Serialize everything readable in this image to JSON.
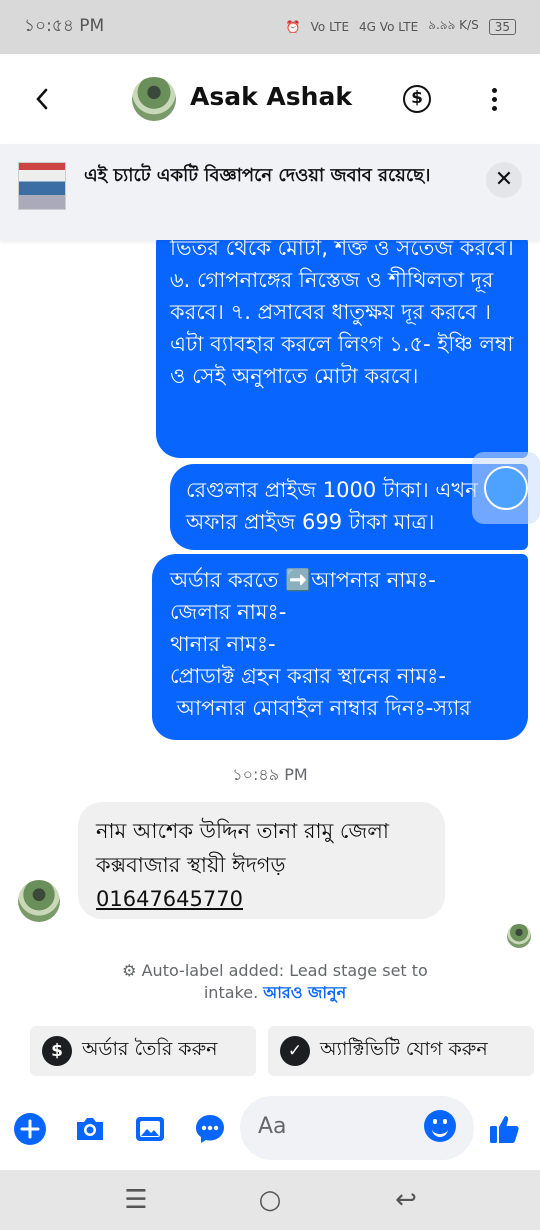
{
  "status_bar": {
    "time": "১০:৫৪ PM",
    "signal1": "Vo LTE",
    "signal2": "4G Vo LTE",
    "speed": "৯.৯৯ K/S",
    "battery": "35"
  },
  "header": {
    "contact_name": "Asak Ashak",
    "back_icon": "chevron-left-icon",
    "dollar_icon": "dollar-circle-icon",
    "more_icon": "vertical-dots-icon"
  },
  "ad_banner": {
    "text": "এই চ্যাটে একটি বিজ্ঞাপনে দেওয়া জবাব রয়েছে।",
    "close_icon": "close-icon"
  },
  "messages": {
    "out1": "ভিতর থেকে মোটা, শক্ত ও সতেজ করবে। ৬. গোপনাঙ্গের নিস্তেজ ও শীথিলতা দূর করবে। ৭. প্রসাবের ধাতুক্ষয় দূর করবে । এটা ব্যাবহার করলে লিংগ ১.৫- ইঞ্চি লম্বা ও সেই অনুপাতে মোটা করবে।",
    "out2": "রেগুলার প্রাইজ 1000 টাকা। এখন অফার প্রাইজ 699 টাকা মাত্র।",
    "out3_line1": "অর্ডার করতে ➡️আপনার নামঃ-",
    "out3_line2": "জেলার নামঃ-",
    "out3_line3": "থানার নামঃ-",
    "out3_line4": "প্রোডাক্ট গ্রহন করার স্থানের নামঃ-",
    "out3_line5": " আপনার মোবাইল নাম্বার দিনঃ-স্যার",
    "timestamp": "১০:৪৯ PM",
    "in1_text": "নাম আশেক উদ্দিন তানা রামু জেলা কক্সবাজার স্থায়ী ঈদগড়",
    "in1_phone": "01647645770"
  },
  "auto_label": {
    "text": "Auto-label added: Lead stage set to intake.",
    "link": "আরও জানুন"
  },
  "actions": {
    "create_order": "অর্ডার তৈরি করুন",
    "add_activity": "অ্যাক্টিভিটি যোগ করুন"
  },
  "composer": {
    "placeholder": "Aa"
  },
  "colors": {
    "messenger_blue": "#0866ff",
    "incoming_bubble": "#f0f0f0"
  }
}
